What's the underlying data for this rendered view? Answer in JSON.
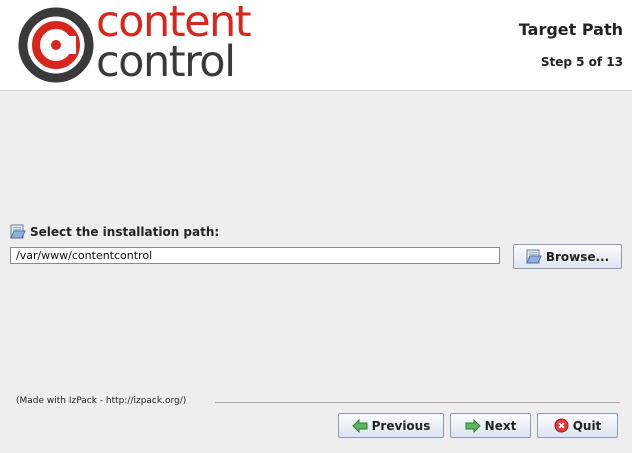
{
  "header": {
    "logo": {
      "line1": "content",
      "line2": "control"
    },
    "step_title": "Target Path",
    "step_counter": "Step 5 of 13"
  },
  "target": {
    "label": "Select the installation path:",
    "path_value": "/var/www/contentcontrol",
    "browse_label": "Browse..."
  },
  "footer": {
    "made_with": "(Made with IzPack - http://izpack.org/)",
    "previous_label": "Previous",
    "next_label": "Next",
    "quit_label": "Quit"
  },
  "colors": {
    "brand_red": "#d9261c",
    "brand_gray": "#3a3a3a"
  },
  "icons": [
    "folder-icon",
    "arrow-left-icon",
    "arrow-right-icon",
    "close-icon"
  ]
}
